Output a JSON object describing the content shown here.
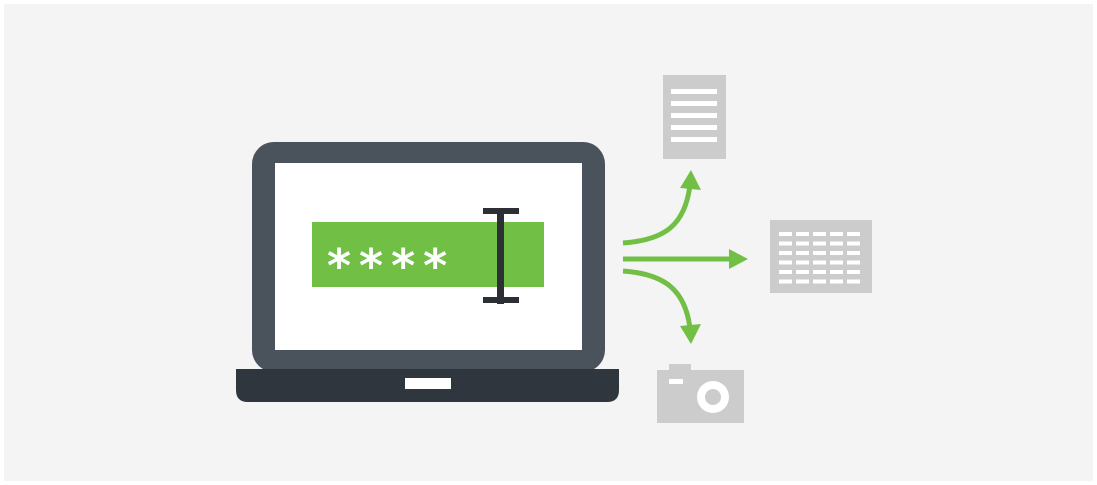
{
  "background_color": "#f4f4f4",
  "laptop": {
    "frame_color": "#4a525b",
    "base_color": "#30363e",
    "screen_color": "#ffffff",
    "trackpad_color": "#ffffff"
  },
  "password_field": {
    "masked_value": "****",
    "fill_color": "#71bf44",
    "text_color": "#ffffff",
    "cursor_icon": "text-cursor-icon",
    "cursor_color": "#2c2f33"
  },
  "arrows": {
    "color": "#71bf44",
    "items": [
      "arrow-up-icon",
      "arrow-right-icon",
      "arrow-down-icon"
    ]
  },
  "outputs": {
    "icon_color": "#cccccc",
    "items": [
      "document-icon",
      "spreadsheet-icon",
      "camera-icon"
    ]
  }
}
